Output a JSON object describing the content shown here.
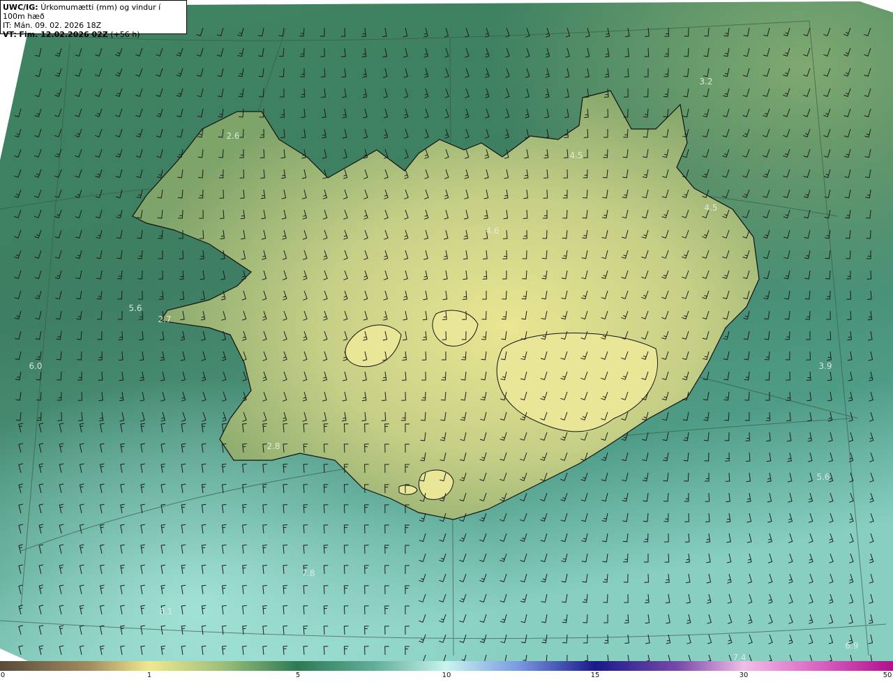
{
  "header": {
    "model": "UWC/IG:",
    "parameter": "Úrkomumætti (mm) og vindur í 100m hæð",
    "init_time": "IT: Mán. 09. 02. 2026 18Z",
    "valid_prefix": "VT:",
    "valid_time": "Fim. 12.02.2026 02Z",
    "lead": "(+56 h)"
  },
  "colorbar": {
    "ticks": [
      "0",
      "1",
      "5",
      "10",
      "15",
      "30",
      "50"
    ],
    "colors": [
      "#5a4a3a",
      "#c8b56a",
      "#f0e890",
      "#2e7a55",
      "#9fe0d8",
      "#2020a0",
      "#e070c0",
      "#c020a0"
    ]
  },
  "map_labels": [
    {
      "text": "3.2"
    },
    {
      "text": "2.6"
    },
    {
      "text": "4.5"
    },
    {
      "text": "4.5"
    },
    {
      "text": "4.6"
    },
    {
      "text": "5.6"
    },
    {
      "text": "2.7"
    },
    {
      "text": "6.0"
    },
    {
      "text": "3.9"
    },
    {
      "text": "2.8"
    },
    {
      "text": "5.6"
    },
    {
      "text": "7.8"
    },
    {
      "text": "8.1"
    },
    {
      "text": "6.9"
    },
    {
      "text": "7.4"
    }
  ],
  "colors": {
    "ocean_dark": "#2f6f58",
    "ocean_light": "#7cc4b4",
    "land_low": "#8aa86a",
    "land_high": "#e8e493",
    "coast": "#111111",
    "barb": "#1a1a1a"
  }
}
